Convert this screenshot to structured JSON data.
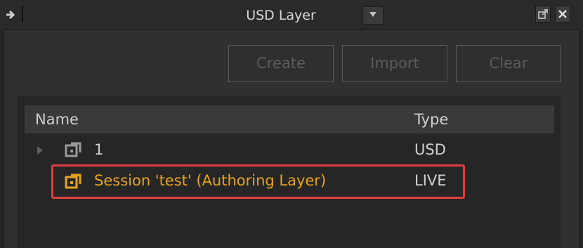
{
  "window": {
    "title": "USD Layer"
  },
  "toolbar": {
    "create_label": "Create",
    "import_label": "Import",
    "clear_label": "Clear"
  },
  "tree": {
    "columns": {
      "name": "Name",
      "type": "Type"
    },
    "rows": [
      {
        "name": "1",
        "type": "USD",
        "icon": "layer-icon",
        "has_children": true,
        "selected": false
      },
      {
        "name": "Session 'test' (Authoring Layer)",
        "type": "LIVE",
        "icon": "live-layer-icon",
        "has_children": false,
        "selected": false,
        "highlighted": true
      }
    ]
  },
  "colors": {
    "live_accent": "#e6a21b",
    "highlight_box": "#e03e3e",
    "disabled_text": "#5b5b5b"
  }
}
